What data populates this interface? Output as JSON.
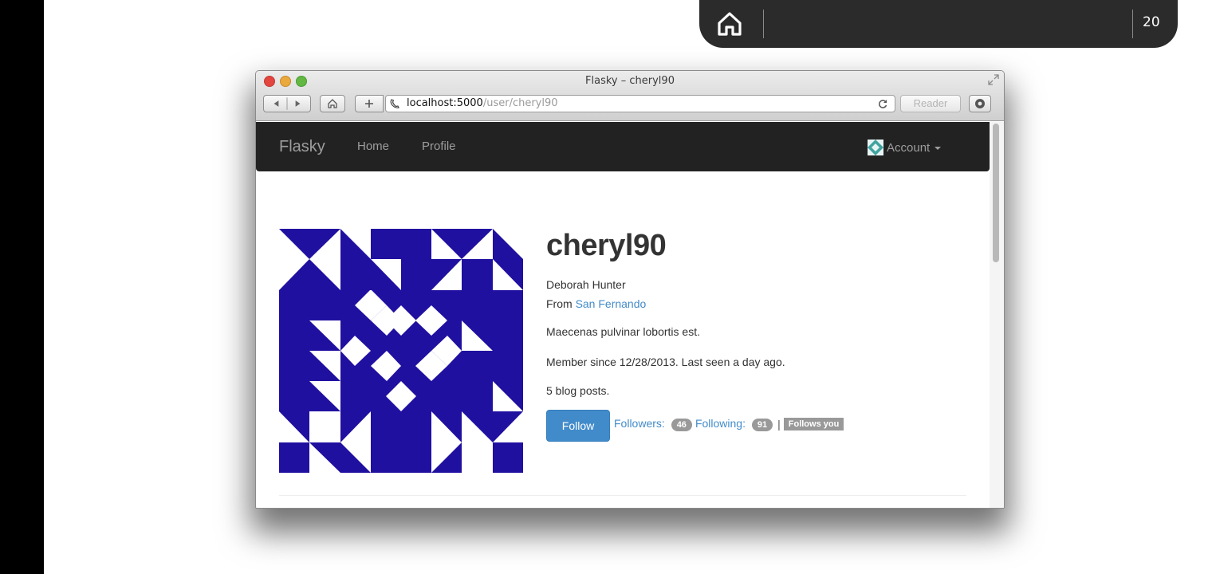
{
  "slide": {
    "page_number": "20"
  },
  "window": {
    "title": "Flasky – cheryl90"
  },
  "address_bar": {
    "host": "localhost:5000",
    "path": "/user/cheryl90",
    "reader_label": "Reader"
  },
  "navbar": {
    "brand": "Flasky",
    "links": [
      "Home",
      "Profile"
    ],
    "account_label": "Account"
  },
  "profile": {
    "username": "cheryl90",
    "full_name": "Deborah Hunter",
    "from_prefix": "From",
    "location": "San Fernando",
    "about": "Maecenas pulvinar lobortis est.",
    "member_info": "Member since 12/28/2013. Last seen a day ago.",
    "post_count": "5 blog posts.",
    "follow_button": "Follow",
    "followers_label": "Followers:",
    "followers_count": "46",
    "following_label": "Following:",
    "following_count": "91",
    "separator": "|",
    "follows_you": "Follows you"
  },
  "colors": {
    "navbar_bg": "#222222",
    "link": "#428bca",
    "primary_button": "#428bca",
    "avatar_blue": "#2010a0",
    "badge": "#999999"
  },
  "icons": [
    "home-icon",
    "back-arrow-icon",
    "forward-arrow-icon",
    "browser-home-icon",
    "add-tab-icon",
    "phone-icon",
    "reload-icon",
    "download-icon",
    "fullscreen-icon",
    "account-avatar-icon",
    "caret-down-icon"
  ]
}
